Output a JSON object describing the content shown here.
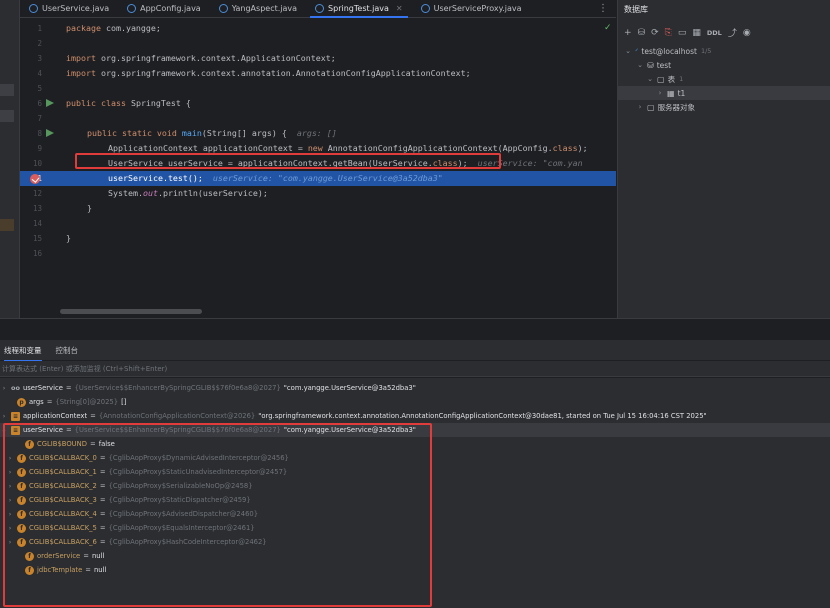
{
  "tabs": [
    {
      "label": "UserService.java",
      "active": false
    },
    {
      "label": "AppConfig.java",
      "active": false
    },
    {
      "label": "YangAspect.java",
      "active": false
    },
    {
      "label": "SpringTest.java",
      "active": true
    },
    {
      "label": "UserServiceProxy.java",
      "active": false
    }
  ],
  "tab_more": "⋮",
  "editor": {
    "line_numbers": [
      "1",
      "2",
      "3",
      "4",
      "5",
      "6",
      "7",
      "8",
      "9",
      "10",
      "11",
      "12",
      "13",
      "14",
      "15",
      "16"
    ],
    "l1": {
      "kw": "package",
      "rest": " com.yangge;"
    },
    "l3": {
      "kw": "import",
      "rest": " org.springframework.context.ApplicationContext;"
    },
    "l4": {
      "kw": "import",
      "rest": " org.springframework.context.annotation.AnnotationConfigApplicationContext;"
    },
    "l6": {
      "kw": "public class",
      "name": " SpringTest",
      "rest": " {"
    },
    "l8": {
      "kw": "public static void",
      "fn": " main",
      "rest": "(String[] args) {",
      "hint": "args: []"
    },
    "l9": {
      "a": "ApplicationContext applicationContext = ",
      "kw": "new",
      "b": " AnnotationConfigApplicationContext(AppConfig.",
      "kw2": "class",
      "c": ");"
    },
    "l10": {
      "a": "UserService userService = applicationContext.getBean(UserService.",
      "kw": "class",
      "b": ");",
      "hint": "userService: \"com.yan"
    },
    "l11": {
      "a": "userService.test();",
      "hint": "userService: \"com.yangge.UserService@3a52dba3\""
    },
    "l12": {
      "a": "System.",
      "it": "out",
      "b": ".println(userService);"
    },
    "l13": {
      "a": "}"
    },
    "l15": {
      "a": "}"
    }
  },
  "db_panel": {
    "title": "数据库",
    "toolbar": [
      "+",
      "⛁",
      "⟳",
      "⎘",
      "▭",
      "▦",
      "DDL",
      "⤴",
      "◉"
    ],
    "tree": [
      {
        "label": "test@localhost",
        "badge": "1/5",
        "toggle": "⌄",
        "icon": "ᐟ"
      },
      {
        "label": "test",
        "badge": "",
        "toggle": "⌄",
        "icon": "⛁"
      },
      {
        "label": "表",
        "badge": "1",
        "toggle": "⌄",
        "icon": "▢"
      },
      {
        "label": "t1",
        "badge": "",
        "toggle": "›",
        "icon": "▦"
      },
      {
        "label": "服务器对象",
        "badge": "",
        "toggle": "›",
        "icon": "▢"
      }
    ]
  },
  "debug": {
    "tabs": [
      "线程和变量",
      "控制台"
    ],
    "eval_placeholder": "计算表达式 (Enter) 或添加监视 (Ctrl+Shift+Enter)",
    "vars": [
      {
        "toggle": "›",
        "icon": "oo",
        "name": "userService",
        "type": "{UserService$$EnhancerBySpringCGLIB$$76f0e6a8@2027}",
        "value": "\"com.yangge.UserService@3a52dba3\""
      },
      {
        "toggle": "",
        "icon": "p",
        "name": "args",
        "type": "{String[0]@2025}",
        "value": "[]"
      },
      {
        "toggle": "›",
        "icon": "≡",
        "name": "applicationContext",
        "type": "{AnnotationConfigApplicationContext@2026}",
        "value": "\"org.springframework.context.annotation.AnnotationConfigApplicationContext@30dae81, started on Tue Jul 15 16:04:16 CST 2025\""
      },
      {
        "toggle": "⌄",
        "icon": "≡",
        "name": "userService",
        "type": "{UserService$$EnhancerBySpringCGLIB$$76f0e6a8@2027}",
        "value": "\"com.yangge.UserService@3a52dba3\""
      },
      {
        "toggle": "",
        "icon": "f",
        "name": "CGLIB$BOUND",
        "type": "",
        "value": "false"
      },
      {
        "toggle": "›",
        "icon": "f",
        "name": "CGLIB$CALLBACK_0",
        "type": "{CglibAopProxy$DynamicAdvisedInterceptor@2456}",
        "value": ""
      },
      {
        "toggle": "›",
        "icon": "f",
        "name": "CGLIB$CALLBACK_1",
        "type": "{CglibAopProxy$StaticUnadvisedInterceptor@2457}",
        "value": ""
      },
      {
        "toggle": "›",
        "icon": "f",
        "name": "CGLIB$CALLBACK_2",
        "type": "{CglibAopProxy$SerializableNoOp@2458}",
        "value": ""
      },
      {
        "toggle": "›",
        "icon": "f",
        "name": "CGLIB$CALLBACK_3",
        "type": "{CglibAopProxy$StaticDispatcher@2459}",
        "value": ""
      },
      {
        "toggle": "›",
        "icon": "f",
        "name": "CGLIB$CALLBACK_4",
        "type": "{CglibAopProxy$AdvisedDispatcher@2460}",
        "value": ""
      },
      {
        "toggle": "›",
        "icon": "f",
        "name": "CGLIB$CALLBACK_5",
        "type": "{CglibAopProxy$EqualsInterceptor@2461}",
        "value": ""
      },
      {
        "toggle": "›",
        "icon": "f",
        "name": "CGLIB$CALLBACK_6",
        "type": "{CglibAopProxy$HashCodeInterceptor@2462}",
        "value": ""
      },
      {
        "toggle": "",
        "icon": "f",
        "name": "orderService",
        "type": "",
        "value": "null"
      },
      {
        "toggle": "",
        "icon": "f",
        "name": "jdbcTemplate",
        "type": "",
        "value": "null"
      }
    ]
  },
  "colors": {
    "accent": "#3574f0",
    "highlight": "#2154a5",
    "annotation_red": "#e03c3c"
  }
}
